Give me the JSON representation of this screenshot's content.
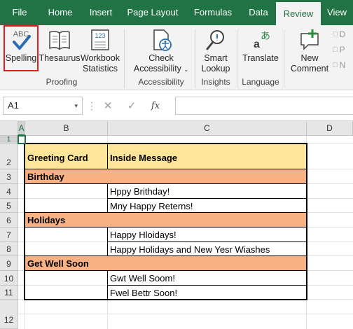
{
  "tabs": [
    {
      "label": "File",
      "active": false
    },
    {
      "label": "Home",
      "active": false
    },
    {
      "label": "Insert",
      "active": false
    },
    {
      "label": "Page Layout",
      "active": false
    },
    {
      "label": "Formulas",
      "active": false
    },
    {
      "label": "Data",
      "active": false
    },
    {
      "label": "Review",
      "active": true
    },
    {
      "label": "View",
      "active": false
    }
  ],
  "ribbon": {
    "proofing": {
      "label": "Proofing",
      "spelling": "Spelling",
      "spelling_icon_text": "ABC",
      "thesaurus": "Thesaurus",
      "workbook_stats_line1": "Workbook",
      "workbook_stats_line2": "Statistics",
      "workbook_stats_icon_text": "123"
    },
    "accessibility": {
      "label": "Accessibility",
      "check_line1": "Check",
      "check_line2": "Accessibility"
    },
    "insights": {
      "label": "Insights",
      "smart_line1": "Smart",
      "smart_line2": "Lookup"
    },
    "language": {
      "label": "Language",
      "translate": "Translate"
    },
    "comments": {
      "new_line1": "New",
      "new_line2": "Comment",
      "small_items": [
        "D",
        "P",
        "N"
      ]
    }
  },
  "formula_bar": {
    "name_box": "A1",
    "cancel_symbol": "✕",
    "enter_symbol": "✓",
    "fx_symbol": "fx",
    "value": ""
  },
  "columns": [
    "A",
    "B",
    "C",
    "D"
  ],
  "rows": [
    "1",
    "2",
    "3",
    "4",
    "5",
    "6",
    "7",
    "8",
    "9",
    "10",
    "11",
    "12"
  ],
  "table": {
    "header_b": "Greeting Card",
    "header_c": "Inside Message",
    "sections": [
      {
        "title": "Birthday",
        "messages": [
          "Hppy Brithday!",
          "Mny Happy Reterns!"
        ]
      },
      {
        "title": "Holidays",
        "messages": [
          "Happy Hloidays!",
          "Happy Holidays and New Yesr Wiashes"
        ]
      },
      {
        "title": "Get Well Soon",
        "messages": [
          "Gwt Well Soom!",
          "Fwel Bettr Soon!"
        ]
      }
    ]
  },
  "colors": {
    "accent": "#217346",
    "header_fill": "#ffe59a",
    "section_fill": "#f7b183",
    "highlight_box": "#e02020"
  }
}
